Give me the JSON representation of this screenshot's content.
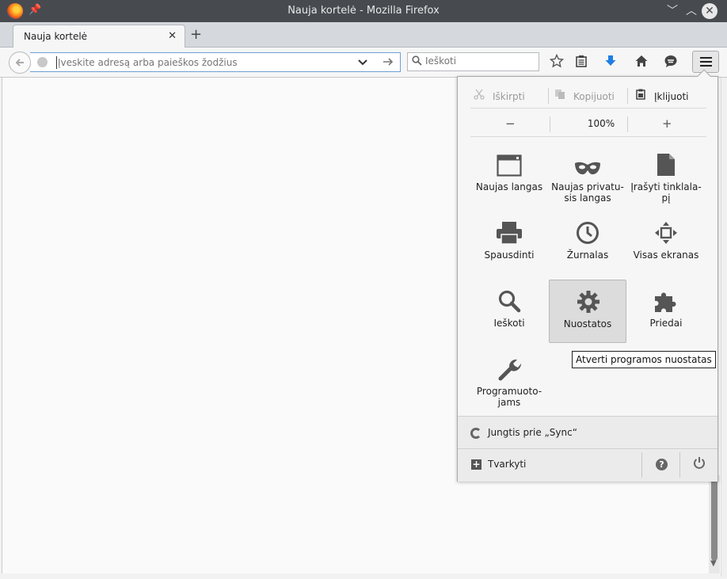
{
  "window": {
    "title": "Nauja kortelė - Mozilla Firefox",
    "controls": [
      "minimize",
      "maximize",
      "close"
    ]
  },
  "tabs": [
    {
      "label": "Nauja kortelė",
      "close": "✕",
      "active": true
    }
  ],
  "new_tab_label": "+",
  "navbar": {
    "url_placeholder": "Įveskite adresą arba paieškos žodžius",
    "search_placeholder": "Ieškoti",
    "toolbar_icons": [
      "star-icon",
      "reading-list-icon",
      "download-icon",
      "home-icon",
      "chat-icon",
      "menu-icon"
    ]
  },
  "panel": {
    "edit": {
      "cut": "Iškirpti",
      "copy": "Kopijuoti",
      "paste": "Įklijuoti"
    },
    "zoom": {
      "minus": "−",
      "value": "100%",
      "plus": "+"
    },
    "tiles": [
      {
        "name": "new-window",
        "label": "Naujas langas",
        "icon": "window-icon"
      },
      {
        "name": "new-private-window",
        "label": "Naujas privatu-sis langas",
        "icon": "mask-icon"
      },
      {
        "name": "save-page",
        "label": "Įrašyti tinklala-pį",
        "icon": "page-icon"
      },
      {
        "name": "print",
        "label": "Spausdinti",
        "icon": "printer-icon"
      },
      {
        "name": "history",
        "label": "Žurnalas",
        "icon": "clock-icon"
      },
      {
        "name": "fullscreen",
        "label": "Visas ekranas",
        "icon": "fullscreen-icon"
      },
      {
        "name": "find",
        "label": "Ieškoti",
        "icon": "magnifier-icon"
      },
      {
        "name": "preferences",
        "label": "Nuostatos",
        "icon": "gear-icon"
      },
      {
        "name": "addons",
        "label": "Priedai",
        "icon": "puzzle-icon"
      },
      {
        "name": "developer",
        "label": "Programuoto-jams",
        "icon": "wrench-icon"
      }
    ],
    "tooltip": "Atverti programos nuostatas",
    "sync": "Jungtis prie „Sync“",
    "customize": "Tvarkyti",
    "help_symbol": "?"
  },
  "colors": {
    "titlebar": "#474b50",
    "panel_bg": "#f6f6f6",
    "hover_tile": "#dcdcdc",
    "download_arrow": "#1f7ee6"
  }
}
